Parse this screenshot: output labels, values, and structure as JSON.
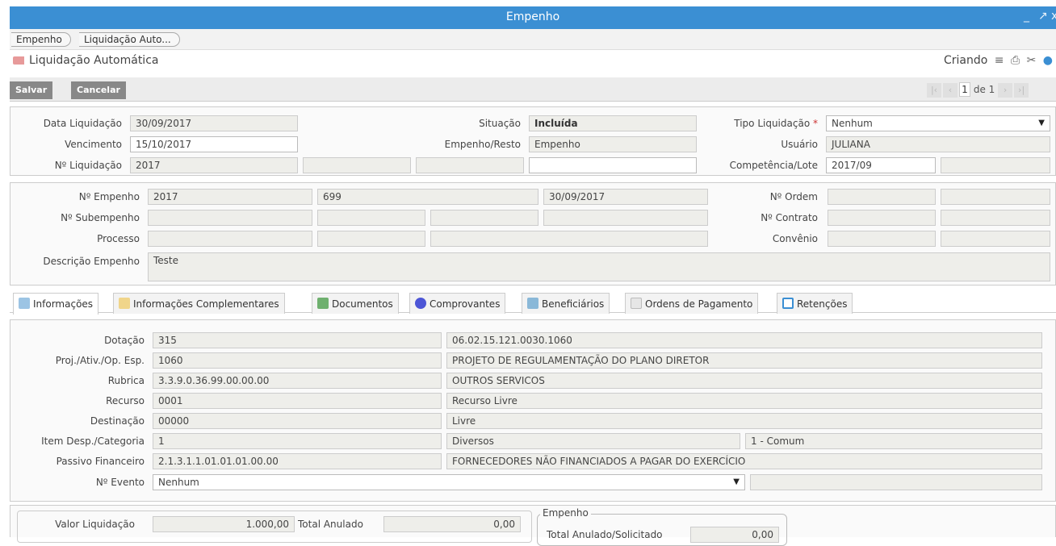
{
  "window": {
    "title": "Empenho",
    "minimize": "_",
    "restore": "↗",
    "close": "x"
  },
  "breadcrumb": [
    "Empenho",
    "Liquidação Auto..."
  ],
  "page": {
    "title": "Liquidação Automática",
    "status": "Criando"
  },
  "toolbar": {
    "save_label": "Salvar",
    "cancel_label": "Cancelar"
  },
  "pager": {
    "current": "1",
    "of_label": "de 1"
  },
  "header": {
    "data_liquidacao_label": "Data Liquidação",
    "data_liquidacao": "30/09/2017",
    "vencimento_label": "Vencimento",
    "vencimento": "15/10/2017",
    "n_liquidacao_label": "Nº Liquidação",
    "n_liquidacao": "2017",
    "situacao_label": "Situação",
    "situacao": "Incluída",
    "empenho_resto_label": "Empenho/Resto",
    "empenho_resto": "Empenho",
    "tipo_liquidacao_label": "Tipo Liquidação",
    "tipo_liquidacao": "Nenhum",
    "usuario_label": "Usuário",
    "usuario": "JULIANA",
    "competencia_label": "Competência/Lote",
    "competencia": "2017/09"
  },
  "empenho": {
    "n_empenho_label": "Nº Empenho",
    "n_empenho_ano": "2017",
    "n_empenho_num": "699",
    "n_empenho_data": "30/09/2017",
    "n_subempenho_label": "Nº Subempenho",
    "processo_label": "Processo",
    "descricao_label": "Descrição Empenho",
    "descricao": "Teste",
    "n_ordem_label": "Nº Ordem",
    "n_contrato_label": "Nº Contrato",
    "convenio_label": "Convênio"
  },
  "tabs": [
    {
      "label": "Informações",
      "icon": "share-icon"
    },
    {
      "label": "Informações Complementares",
      "icon": "list-icon"
    },
    {
      "label": "Documentos",
      "icon": "spreadsheet-icon"
    },
    {
      "label": "Comprovantes",
      "icon": "circle-icon"
    },
    {
      "label": "Beneficiários",
      "icon": "users-icon"
    },
    {
      "label": "Ordens de Pagamento",
      "icon": "page-icon"
    },
    {
      "label": "Retenções",
      "icon": "window-icon"
    }
  ],
  "info": {
    "dotacao_label": "Dotação",
    "dotacao": "315",
    "dotacao_desc": "06.02.15.121.0030.1060",
    "proj_label": "Proj./Ativ./Op. Esp.",
    "proj": "1060",
    "proj_desc": "PROJETO DE REGULAMENTAÇÃO DO PLANO DIRETOR",
    "rubrica_label": "Rubrica",
    "rubrica": "3.3.9.0.36.99.00.00.00",
    "rubrica_desc": "OUTROS SERVICOS",
    "recurso_label": "Recurso",
    "recurso": "0001",
    "recurso_desc": "Recurso Livre",
    "destinacao_label": "Destinação",
    "destinacao": "00000",
    "destinacao_desc": "Livre",
    "item_label": "Item Desp./Categoria",
    "item": "1",
    "item_desc": "Diversos",
    "categoria": "1 - Comum",
    "passivo_label": "Passivo Financeiro",
    "passivo": "2.1.3.1.1.01.01.01.00.00",
    "passivo_desc": "FORNECEDORES NÃO FINANCIADOS A PAGAR DO EXERCÍCIO",
    "evento_label": "Nº Evento",
    "evento": "Nenhum"
  },
  "valores": {
    "valor_liquidacao_label": "Valor Liquidação",
    "valor_liquidacao": "1.000,00",
    "total_anulado_label": "Total Anulado",
    "total_anulado": "0,00",
    "empenho_legend": "Empenho",
    "total_anulado_solicitado_label": "Total Anulado/Solicitado",
    "total_anulado_solicitado": "0,00"
  }
}
